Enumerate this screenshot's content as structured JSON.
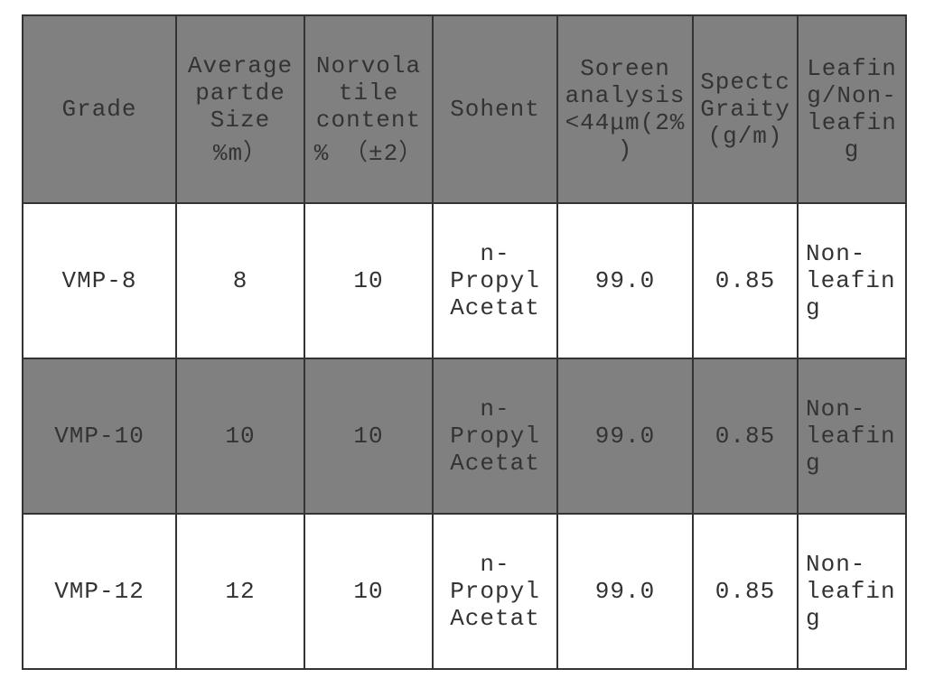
{
  "chart_data": {
    "type": "table",
    "columns": [
      "Grade",
      "Average partde Size   %m）",
      "Norvolatile content % （±2）",
      "Sohent",
      "Soreen analysis <44μm(2%)",
      "Spectc Graity (g/m)",
      "Leafing/Non-leafing"
    ],
    "rows": [
      [
        "VMP-8",
        8,
        10,
        "n-Propyl Acetat",
        99.0,
        0.85,
        "Non-leafing"
      ],
      [
        "VMP-10",
        10,
        10,
        "n-Propyl Acetat",
        99.0,
        0.85,
        "Non-leafing"
      ],
      [
        "VMP-12",
        12,
        10,
        "n-Propyl Acetat",
        99.0,
        0.85,
        "Non-leafing"
      ]
    ]
  },
  "headers": {
    "c0": "Grade",
    "c1": "Average partde Size   %m）",
    "c2": "Norvolatile content %\n（±2）",
    "c3": "Sohent",
    "c4": "Soreen analysis <44μm(2%)",
    "c5": "Spectc Graity (g/m)",
    "c6": "Leafing/Non-leafing"
  },
  "rows": [
    {
      "grade": "VMP-8",
      "size": "8",
      "nv": "10",
      "sohent": "n-Propyl Acetat",
      "screen": "99.0",
      "sg": "0.85",
      "leaf": "Non-leafing"
    },
    {
      "grade": "VMP-10",
      "size": "10",
      "nv": "10",
      "sohent": "n-Propyl Acetat",
      "screen": "99.0",
      "sg": "0.85",
      "leaf": "Non-leafing"
    },
    {
      "grade": "VMP-12",
      "size": "12",
      "nv": "10",
      "sohent": "n-Propyl Acetat",
      "screen": "99.0",
      "sg": "0.85",
      "leaf": "Non-leafing"
    }
  ]
}
